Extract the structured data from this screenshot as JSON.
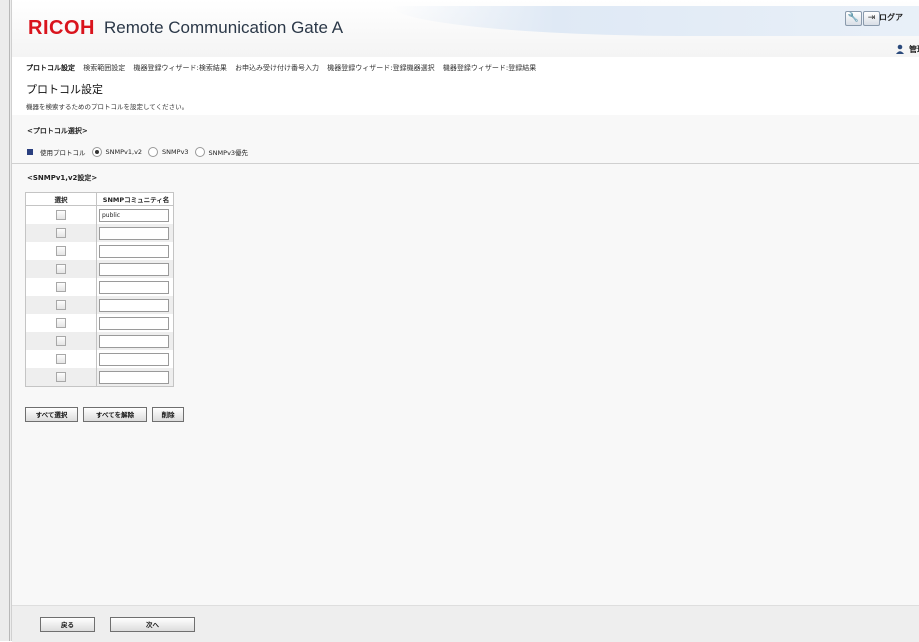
{
  "header": {
    "logo": "RICOH",
    "product": "Remote Communication Gate A",
    "tools_icon": "wrench-icon",
    "logout_icon": "logout-arrow-icon",
    "logout_label": "ログア",
    "user_icon": "user-icon",
    "user_label": "管理"
  },
  "nav": {
    "steps": [
      "プロトコル設定",
      "検索範囲設定",
      "機器登録ウィザード:検索結果",
      "お申込み受け付け番号入力",
      "機器登録ウィザード:登録機器選択",
      "機器登録ウィザード:登録結果"
    ],
    "active_index": 0
  },
  "page": {
    "title": "プロトコル設定",
    "description": "機器を検索するためのプロトコルを設定してください。"
  },
  "protocol_section": {
    "title": "<プロトコル選択>",
    "label": "使用プロトコル",
    "options": [
      "SNMPv1,v2",
      "SNMPv3",
      "SNMPv3優先"
    ],
    "selected": "SNMPv1,v2"
  },
  "snmp_section": {
    "title": "<SNMPv1,v2設定>",
    "headers": {
      "select": "選択",
      "community": "SNMPコミュニティ名"
    },
    "rows": [
      {
        "checked": false,
        "community": "public"
      },
      {
        "checked": false,
        "community": ""
      },
      {
        "checked": false,
        "community": ""
      },
      {
        "checked": false,
        "community": ""
      },
      {
        "checked": false,
        "community": ""
      },
      {
        "checked": false,
        "community": ""
      },
      {
        "checked": false,
        "community": ""
      },
      {
        "checked": false,
        "community": ""
      },
      {
        "checked": false,
        "community": ""
      },
      {
        "checked": false,
        "community": ""
      }
    ]
  },
  "buttons": {
    "select_all": "すべて選択",
    "deselect_all": "すべてを解除",
    "delete": "削除",
    "back": "戻る",
    "next": "次へ"
  }
}
